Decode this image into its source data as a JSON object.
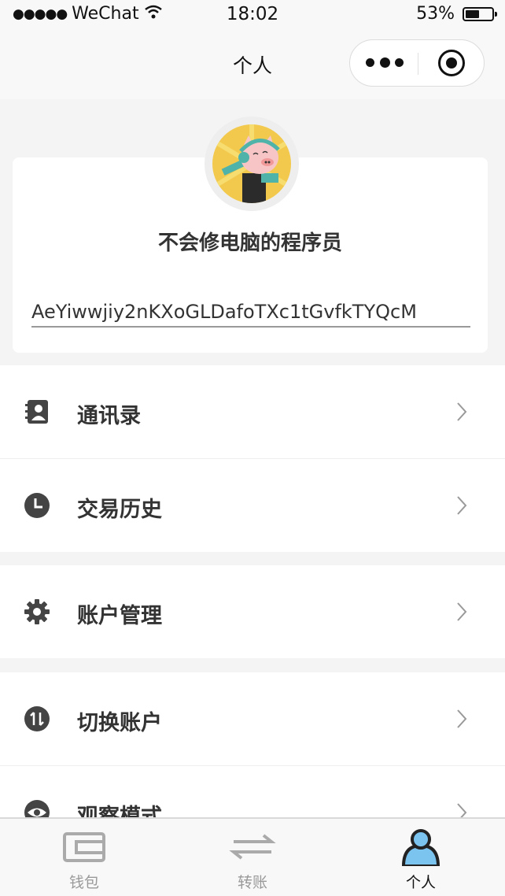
{
  "status_bar": {
    "carrier": "WeChat",
    "time": "18:02",
    "battery_percent": "53%",
    "battery_level": 0.53
  },
  "nav": {
    "title": "个人"
  },
  "profile": {
    "name": "不会修电脑的程序员",
    "address": "AeYiwwjiy2nKXoGLDafoTXc1tGvfkTYQcM"
  },
  "menu": {
    "group1": [
      {
        "label": "通讯录",
        "icon": "contacts-icon"
      },
      {
        "label": "交易历史",
        "icon": "clock-icon"
      }
    ],
    "group2": [
      {
        "label": "账户管理",
        "icon": "gear-icon"
      }
    ],
    "group3": [
      {
        "label": "切换账户",
        "icon": "swap-icon"
      },
      {
        "label": "观察模式",
        "icon": "eye-icon"
      }
    ]
  },
  "tab_bar": {
    "tabs": [
      {
        "label": "钱包",
        "icon": "wallet-icon",
        "active": false
      },
      {
        "label": "转账",
        "icon": "transfer-icon",
        "active": false
      },
      {
        "label": "个人",
        "icon": "person-icon",
        "active": true
      }
    ]
  },
  "colors": {
    "background": "#f4f4f4",
    "active_tab": "#111111",
    "inactive_tab": "#999999",
    "accent_blue": "#7cc4f0"
  }
}
